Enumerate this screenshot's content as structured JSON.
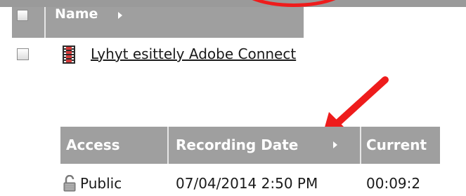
{
  "table1": {
    "header": {
      "name_label": "Name"
    },
    "rows": [
      {
        "title": "Lyhyt esittely Adobe Connect",
        "icon": "film-icon"
      }
    ]
  },
  "table2": {
    "headers": {
      "access": "Access",
      "recording_date": "Recording Date",
      "current": "Current"
    },
    "rows": [
      {
        "access": "Public",
        "access_icon": "unlocked-padlock-icon",
        "recording_date": "07/04/2014 2:50 PM",
        "duration": "00:09:2"
      }
    ]
  },
  "annotation": {
    "color": "#ee1c1c",
    "shapes": [
      "circle",
      "arrow"
    ]
  },
  "colors": {
    "header_bg": "#9f9f9f",
    "header_text": "#ffffff",
    "separator": "#e6e6e6"
  }
}
